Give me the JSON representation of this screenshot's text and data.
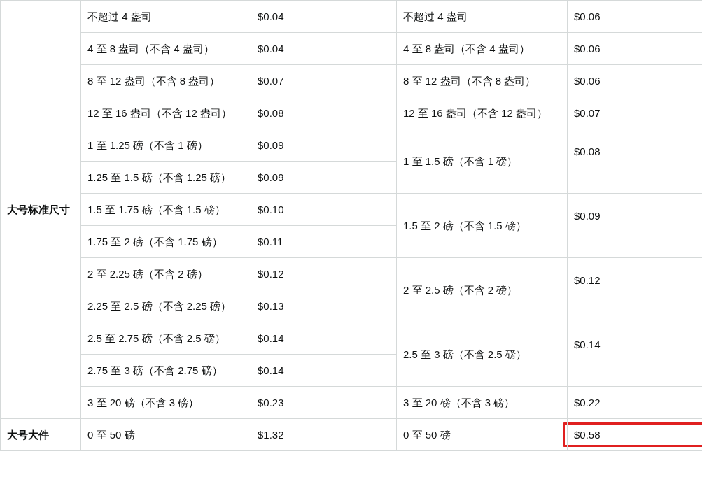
{
  "groups": [
    {
      "category": "大号标准尺寸",
      "rows": [
        {
          "weight_a": "不超过 4 盎司",
          "price_a": "$0.04",
          "right": {
            "weight": "不超过 4 盎司",
            "price": "$0.06",
            "highlighted": false
          }
        },
        {
          "weight_a": "4 至 8 盎司（不含 4 盎司）",
          "price_a": "$0.04",
          "right": {
            "weight": "4 至 8 盎司（不含 4 盎司）",
            "price": "$0.06",
            "highlighted": false
          }
        },
        {
          "weight_a": "8 至 12 盎司（不含 8 盎司）",
          "price_a": "$0.07",
          "right": {
            "weight": "8 至 12 盎司（不含 8 盎司）",
            "price": "$0.06",
            "highlighted": false
          }
        },
        {
          "weight_a": "12 至 16 盎司（不含 12 盎司）",
          "price_a": "$0.08",
          "right": {
            "weight": "12 至 16 盎司（不含 12 盎司）",
            "price": "$0.07",
            "highlighted": false
          }
        },
        {
          "weight_a": "1 至 1.25 磅（不含 1 磅）",
          "price_a": "$0.09",
          "right": {
            "weight": "1 至 1.5 磅（不含 1 磅）",
            "price": "$0.08",
            "highlighted": false
          }
        },
        {
          "weight_a": "1.25 至 1.5 磅（不含 1.25 磅）",
          "price_a": "$0.09"
        },
        {
          "weight_a": "1.5 至 1.75 磅（不含 1.5 磅）",
          "price_a": "$0.10",
          "right": {
            "weight": "1.5 至 2 磅（不含 1.5 磅）",
            "price": "$0.09",
            "highlighted": false
          }
        },
        {
          "weight_a": "1.75 至 2 磅（不含 1.75 磅）",
          "price_a": "$0.11"
        },
        {
          "weight_a": "2 至 2.25 磅（不含 2 磅）",
          "price_a": "$0.12",
          "right": {
            "weight": "2 至 2.5 磅（不含 2 磅）",
            "price": "$0.12",
            "highlighted": false
          }
        },
        {
          "weight_a": "2.25 至 2.5 磅（不含 2.25 磅）",
          "price_a": "$0.13"
        },
        {
          "weight_a": "2.5 至 2.75 磅（不含 2.5 磅）",
          "price_a": "$0.14",
          "right": {
            "weight": "2.5 至 3 磅（不含 2.5 磅）",
            "price": "$0.14",
            "highlighted": false
          }
        },
        {
          "weight_a": "2.75 至 3 磅（不含 2.75 磅）",
          "price_a": "$0.14"
        },
        {
          "weight_a": "3 至 20 磅（不含 3 磅）",
          "price_a": "$0.23",
          "right": {
            "weight": "3 至 20 磅（不含 3 磅）",
            "price": "$0.22",
            "highlighted": false
          }
        }
      ]
    },
    {
      "category": "大号大件",
      "rows": [
        {
          "weight_a": "0 至 50 磅",
          "price_a": "$1.32",
          "right": {
            "weight": "0 至 50 磅",
            "price": "$0.58",
            "highlighted": true
          }
        }
      ]
    }
  ]
}
